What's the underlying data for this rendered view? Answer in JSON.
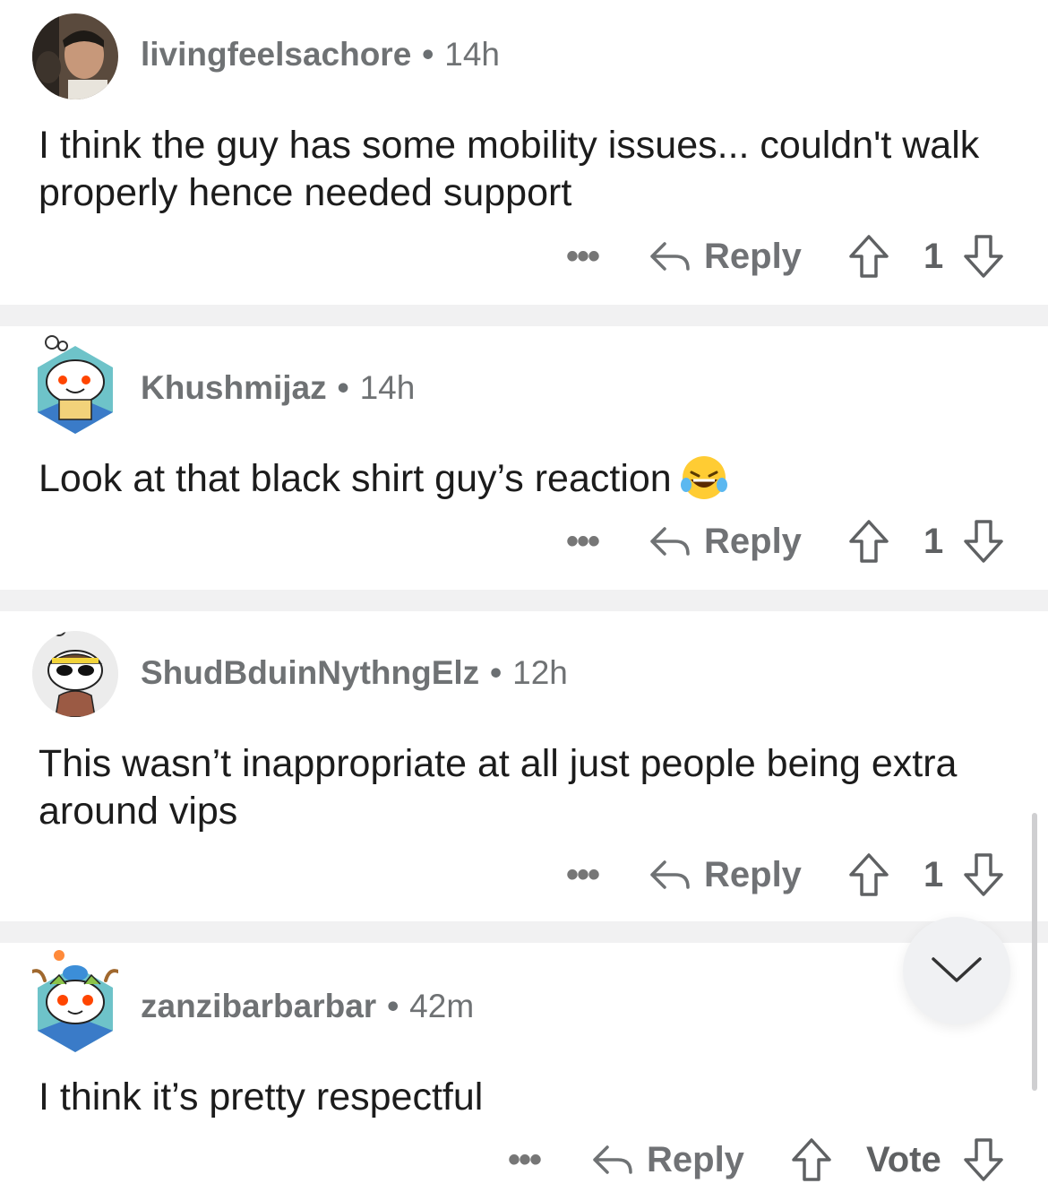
{
  "comments": [
    {
      "username": "livingfeelsachore",
      "time": "14h",
      "text": "I think the guy has some mobility issues... couldn't walk properly hence needed support",
      "more": "•••",
      "reply_label": "Reply",
      "score": "1"
    },
    {
      "username": "Khushmijaz",
      "time": "14h",
      "text": "Look at that black shirt guy’s reaction",
      "emoji": "face-with-tears-of-joy",
      "more": "•••",
      "reply_label": "Reply",
      "score": "1"
    },
    {
      "username": "ShudBduinNythngElz",
      "time": "12h",
      "text": "This wasn’t inappropriate at all just people being extra around vips",
      "more": "•••",
      "reply_label": "Reply",
      "score": "1"
    },
    {
      "username": "zanzibarbarbar",
      "time": "42m",
      "text": "I think it’s pretty respectful",
      "more": "•••",
      "reply_label": "Reply",
      "score": "Vote"
    }
  ],
  "separator": "•",
  "icons": {
    "reply": "reply-arrow-icon",
    "upvote": "upvote-arrow-icon",
    "downvote": "downvote-arrow-icon",
    "collapse": "chevron-down-icon"
  },
  "colors": {
    "text": "#1c1c1c",
    "meta": "#6f7274",
    "divider": "#f1f1f2",
    "reddit_orange": "#ff4500"
  }
}
